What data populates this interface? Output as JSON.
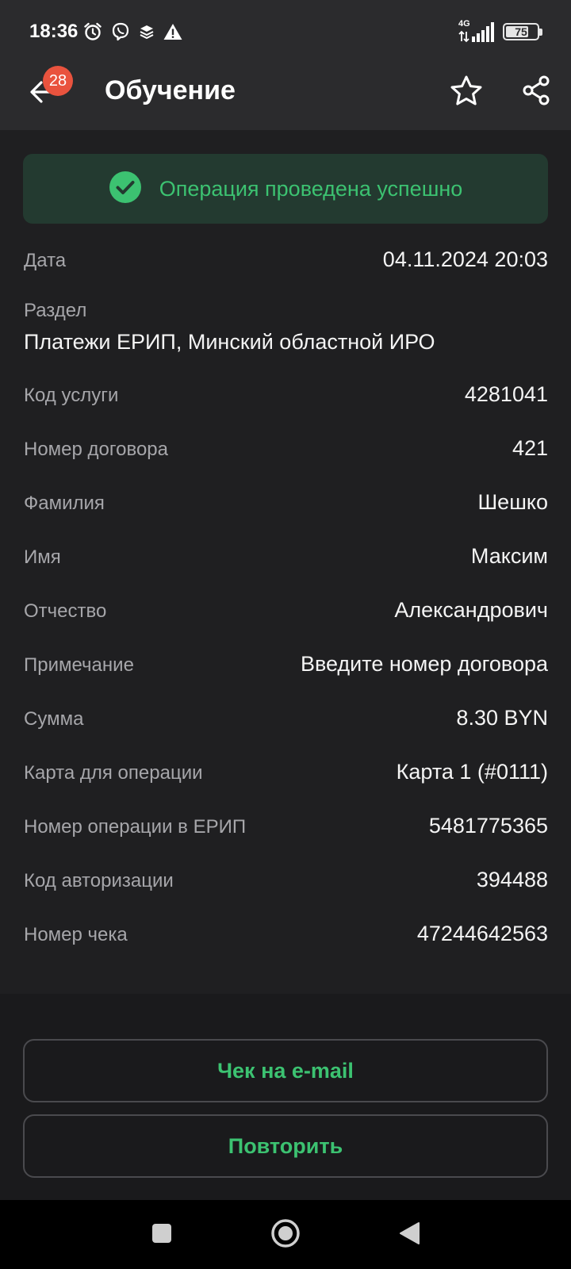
{
  "status_bar": {
    "time": "18:36",
    "left_icons": [
      "alarm-icon",
      "viber-icon",
      "layers-icon",
      "warning-icon"
    ],
    "network": "4G",
    "battery": "75",
    "battery_level": 0.75
  },
  "app_bar": {
    "badge_count": "28",
    "title": "Обучение",
    "icons": [
      "back-arrow-icon",
      "star-icon",
      "share-icon"
    ]
  },
  "banner": {
    "text": "Операция проведена успешно",
    "icon": "check-circle-icon",
    "color": "#3cc271"
  },
  "details": {
    "date": {
      "label": "Дата",
      "value": "04.11.2024 20:03"
    },
    "section": {
      "label": "Раздел",
      "value": "Платежи ЕРИП, Минский областной ИРО"
    },
    "rows": [
      {
        "label": "Код услуги",
        "value": "4281041"
      },
      {
        "label": "Номер договора",
        "value": "421"
      },
      {
        "label": "Фамилия",
        "value": "Шешко"
      },
      {
        "label": "Имя",
        "value": "Максим"
      },
      {
        "label": "Отчество",
        "value": "Александрович"
      },
      {
        "label": "Примечание",
        "value": "Введите номер договора"
      },
      {
        "label": "Сумма",
        "value": "8.30 BYN"
      },
      {
        "label": "Карта для операции",
        "value": "Карта 1 (#0111)"
      },
      {
        "label": "Номер операции в ЕРИП",
        "value": "5481775365"
      },
      {
        "label": "Код авторизации",
        "value": "394488"
      },
      {
        "label": "Номер чека",
        "value": "47244642563"
      }
    ]
  },
  "actions": {
    "email_receipt": "Чек на e-mail",
    "repeat": "Повторить"
  },
  "nav": {
    "icons": [
      "recents-square-icon",
      "home-circle-icon",
      "back-triangle-icon"
    ]
  }
}
